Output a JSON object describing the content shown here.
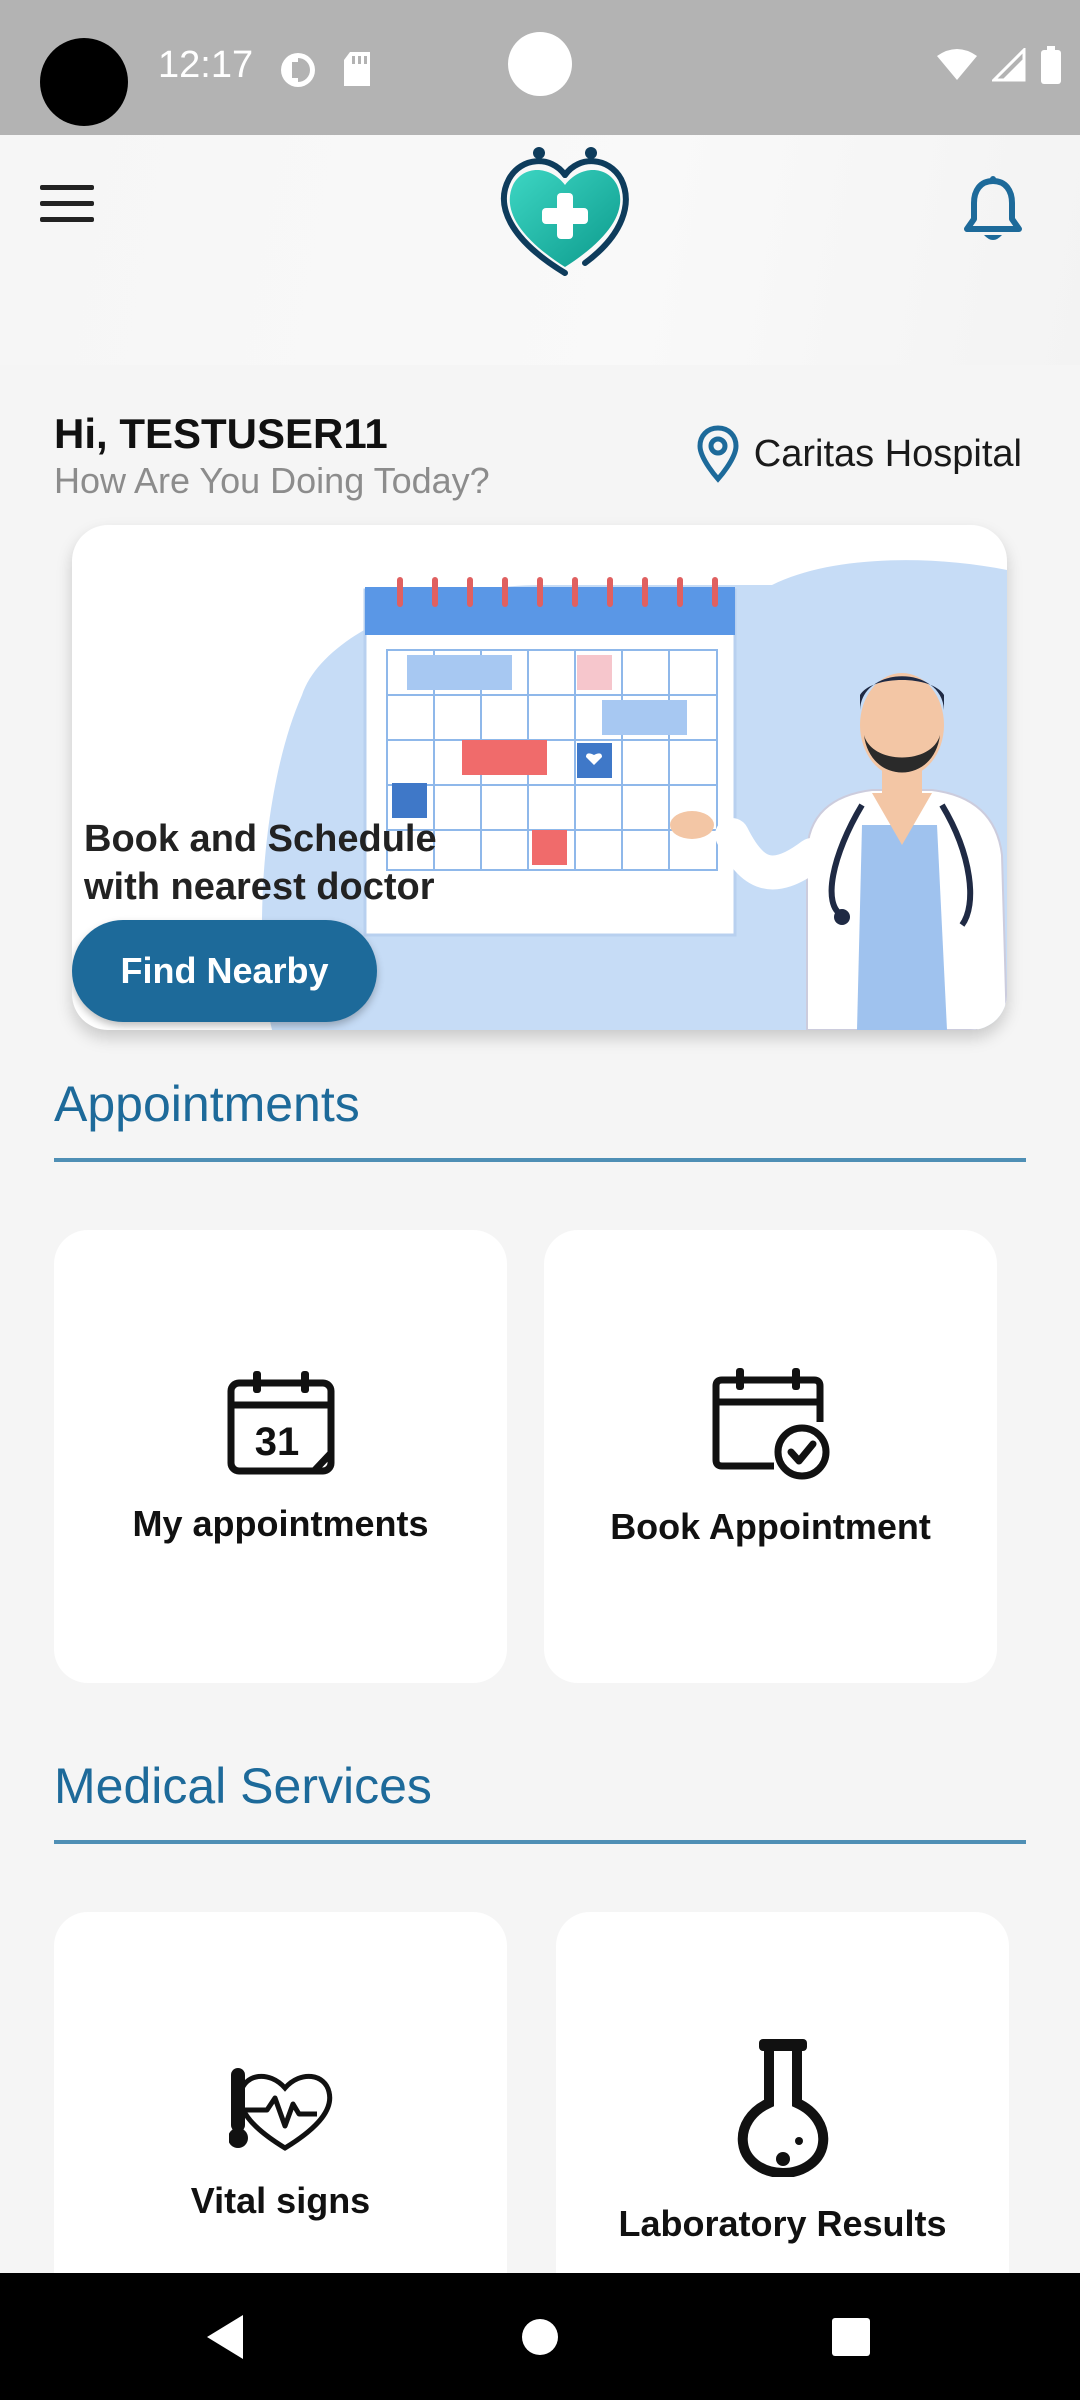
{
  "status_bar": {
    "time": "12:17"
  },
  "header": {
    "menu_icon": "hamburger-menu-icon",
    "logo_icon": "heart-stethoscope-logo",
    "notification_icon": "bell-icon"
  },
  "greeting": {
    "name": "Hi, TESTUSER11",
    "subtitle": "How Are You Doing Today?"
  },
  "location": {
    "icon": "map-pin-icon",
    "hospital": "Caritas Hospital"
  },
  "banner": {
    "text_line1": "Book and Schedule",
    "text_line2": "with nearest doctor",
    "button_label": "Find Nearby"
  },
  "appointments": {
    "title": "Appointments",
    "cards": [
      {
        "label": "My appointments",
        "icon": "calendar-31-icon"
      },
      {
        "label": "Book Appointment",
        "icon": "calendar-check-icon"
      }
    ]
  },
  "medical_services": {
    "title": "Medical Services",
    "cards": [
      {
        "label": "Vital signs",
        "icon": "heart-pulse-icon"
      },
      {
        "label": "Laboratory Results",
        "icon": "flask-icon"
      }
    ]
  },
  "calendar_icon_number": "31",
  "colors": {
    "accent": "#1d6a9a",
    "line": "#4f8fb5",
    "background": "#f5f5f5",
    "status_bar": "#b3b3b3"
  }
}
